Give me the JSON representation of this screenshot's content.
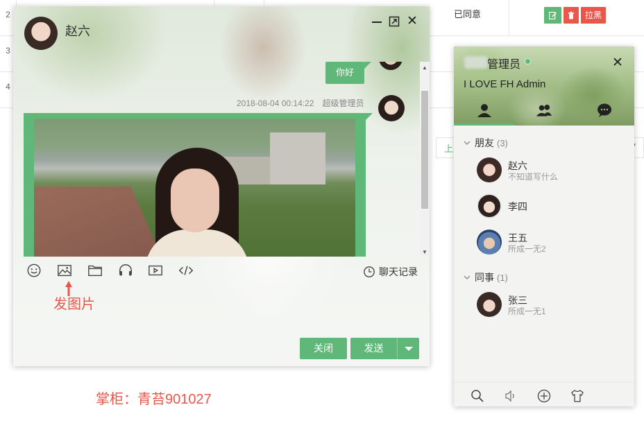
{
  "background_table": {
    "row_numbers": [
      "2",
      "3",
      "4"
    ],
    "status_text": "已同意",
    "blacklist_label": "拉黑",
    "pager_text": "上"
  },
  "chat": {
    "title": "赵六",
    "messages": [
      {
        "text": "你好"
      }
    ],
    "last_meta": {
      "time": "2018-08-04 00:14:22",
      "sender": "超级管理员"
    },
    "history_label": "聊天记录",
    "close_label": "关闭",
    "send_label": "发送"
  },
  "annotation": {
    "label": "发图片",
    "footer": "掌柜：青苔901027"
  },
  "panel": {
    "name": "管理员",
    "sign": "I LOVE FH Admin",
    "groups": [
      {
        "name": "朋友",
        "count": "(3)",
        "members": [
          {
            "name": "赵六",
            "sign": "不知道写什么"
          },
          {
            "name": "李四",
            "sign": ""
          },
          {
            "name": "王五",
            "sign": "所成一无2"
          }
        ]
      },
      {
        "name": "同事",
        "count": "(1)",
        "members": [
          {
            "name": "张三",
            "sign": "所成一无1"
          }
        ]
      }
    ]
  },
  "colors": {
    "accent_green": "#5fb878",
    "danger_red": "#e8574a",
    "online_dot": "#5fb878"
  }
}
